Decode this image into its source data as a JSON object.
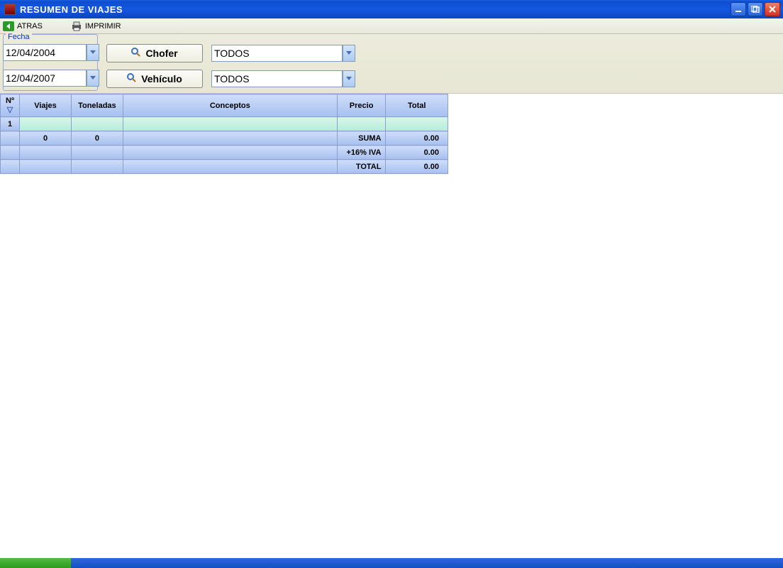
{
  "window": {
    "title": "RESUMEN DE VIAJES"
  },
  "toolbar": {
    "back_label": "ATRAS",
    "print_label": "IMPRIMIR"
  },
  "filters": {
    "fecha_legend": "Fecha",
    "date_from": "12/04/2004",
    "date_to": "12/04/2007",
    "chofer_btn": "Chofer",
    "vehiculo_btn": "Vehículo",
    "chofer_value": "TODOS",
    "vehiculo_value": "TODOS"
  },
  "grid": {
    "headers": {
      "num": "Nº",
      "viajes": "Viajes",
      "toneladas": "Toneladas",
      "conceptos": "Conceptos",
      "precio": "Precio",
      "total": "Total"
    },
    "rows": [
      {
        "num": "1",
        "viajes": "",
        "toneladas": "",
        "conceptos": "",
        "precio": "",
        "total": ""
      }
    ],
    "summary": {
      "viajes_sum": "0",
      "toneladas_sum": "0",
      "suma_label": "SUMA",
      "suma_value": "0.00",
      "iva_label": "+16% IVA",
      "iva_value": "0.00",
      "total_label": "TOTAL",
      "total_value": "0.00"
    }
  }
}
